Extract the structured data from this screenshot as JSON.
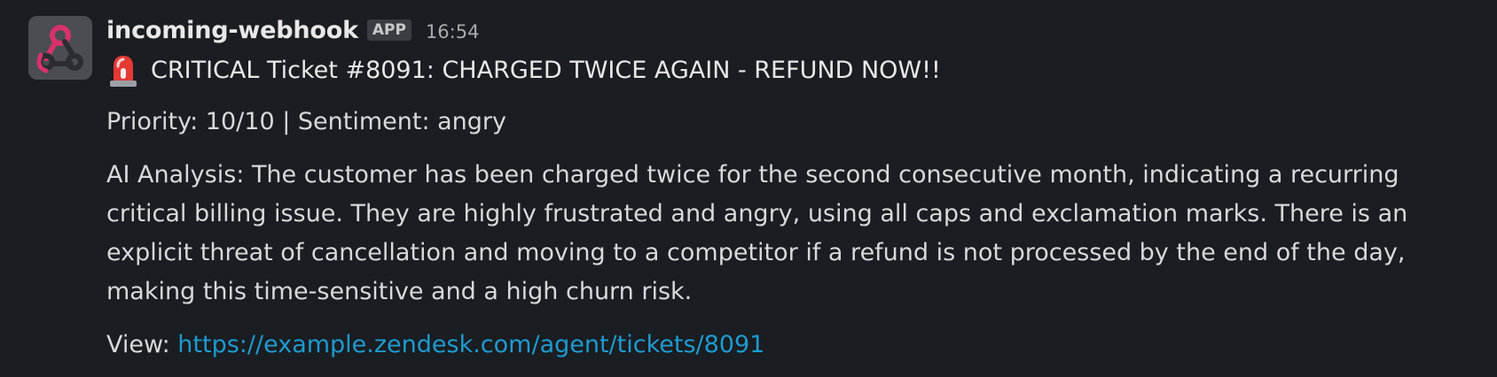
{
  "message": {
    "sender": "incoming-webhook",
    "badge": "APP",
    "timestamp": "16:54",
    "title": "CRITICAL Ticket #8091: CHARGED TWICE AGAIN - REFUND NOW!!",
    "priority_line": "Priority: 10/10 | Sentiment: angry",
    "analysis": "AI Analysis: The customer has been charged twice for the second consecutive month, indicating a recurring critical billing issue. They are highly frustrated and angry, using all caps and exclamation marks. There is an explicit threat of cancellation and moving to a competitor if a refund is not processed by the end of the day, making this time-sensitive and a high churn risk.",
    "view_label": "View:",
    "view_url": "https://example.zendesk.com/agent/tickets/8091"
  },
  "icons": {
    "avatar": "webhook-icon",
    "title_emoji": "rotating-light-icon"
  },
  "colors": {
    "background": "#1a1d21",
    "link": "#1d9bd1",
    "avatar_bg": "#4a4d52",
    "webhook_pink": "#d6336c"
  }
}
